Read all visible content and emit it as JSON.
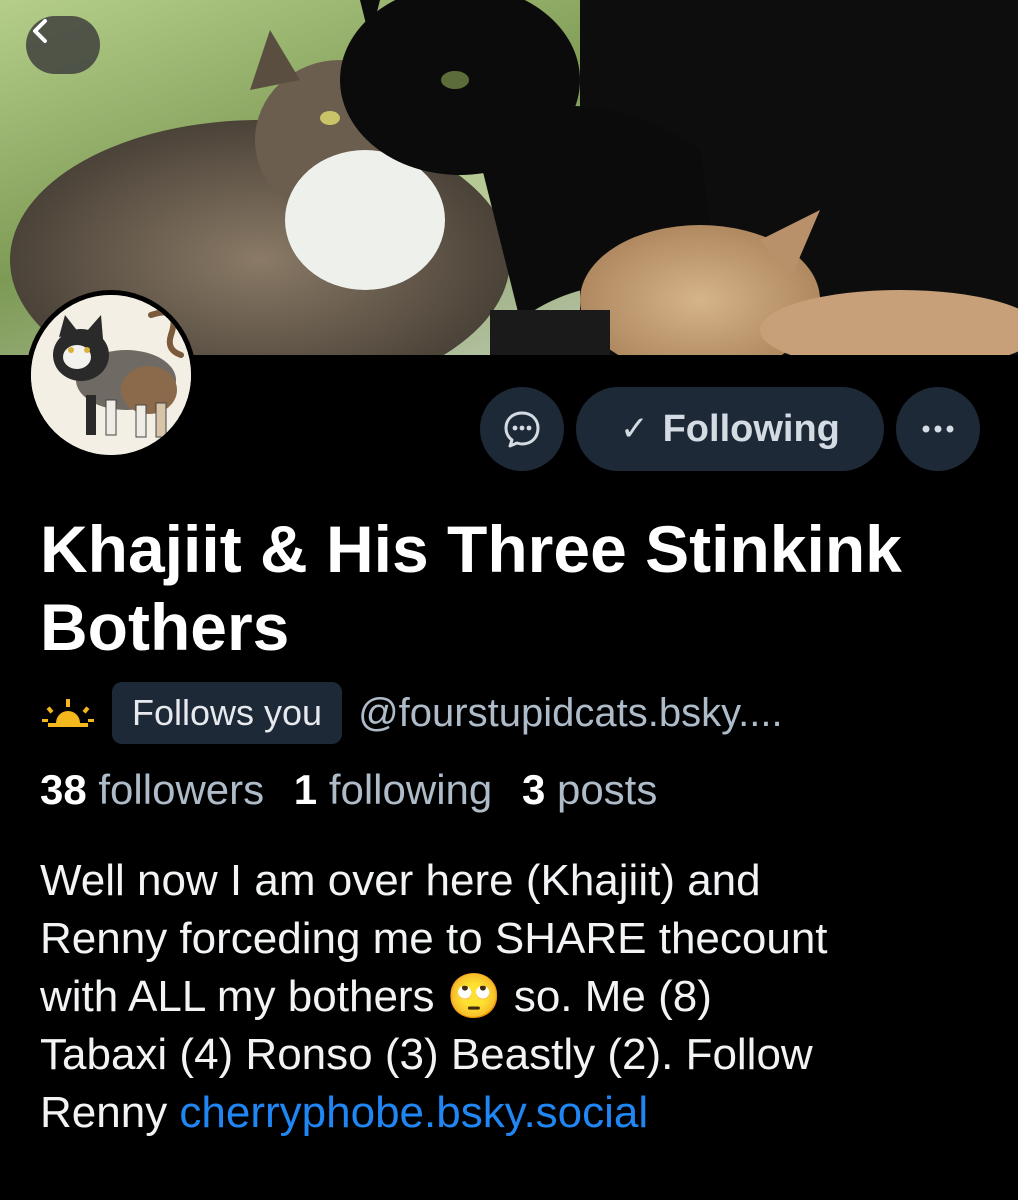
{
  "header": {
    "back_icon": "chevron-left-icon",
    "banner_alt": "cats-banner-photo"
  },
  "profile": {
    "avatar_icon": "cat-drawing-avatar",
    "display_name": "Khajiit & His Three Stinkink Bothers",
    "status_emoji": "sunrise-icon",
    "follows_you_label": "Follows you",
    "handle": "@fourstupidcats.bsky....",
    "stats": {
      "followers_count": "38",
      "followers_label": "followers",
      "following_count": "1",
      "following_label": "following",
      "posts_count": "3",
      "posts_label": "posts"
    },
    "bio": {
      "line1": "Well now I am over here (Khajiit) and",
      "line2": "Renny forceding me to SHARE thecount",
      "line3_a": "with ALL my bothers",
      "emoji": "🙄",
      "line3_b": " so. Me (8)",
      "line4": "Tabaxi (4) Ronso (3) Beastly (2). Follow",
      "line5_a": "Renny ",
      "link": "cherryphobe.bsky.social"
    }
  },
  "actions": {
    "message_icon": "chat-bubble-icon",
    "follow_check": "✓",
    "follow_label": "Following",
    "more_icon": "ellipsis-icon"
  },
  "colors": {
    "background": "#000000",
    "button_bg": "#1e2937",
    "muted_text": "#aebbc9",
    "link": "#1f86f4"
  }
}
